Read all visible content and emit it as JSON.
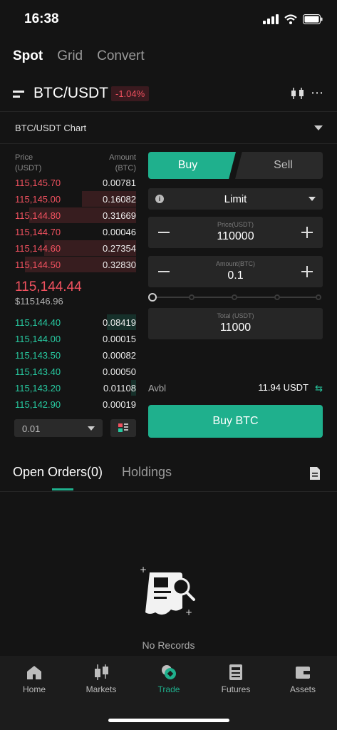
{
  "status_bar": {
    "time": "16:38"
  },
  "top_tabs": [
    "Spot",
    "Grid",
    "Convert"
  ],
  "pair": {
    "name": "BTC/USDT",
    "change": "-1.04%"
  },
  "chart": {
    "label": "BTC/USDT Chart"
  },
  "order_book": {
    "price_header": "Price",
    "price_unit": "(USDT)",
    "amount_header": "Amount",
    "amount_unit": "(BTC)",
    "asks": [
      {
        "price": "115,145.70",
        "amount": "0.00781",
        "depth": 0.0
      },
      {
        "price": "115,145.00",
        "amount": "0.16082",
        "depth": 0.45
      },
      {
        "price": "115,144.80",
        "amount": "0.31669",
        "depth": 0.88
      },
      {
        "price": "115,144.70",
        "amount": "0.00046",
        "depth": 0.0
      },
      {
        "price": "115,144.60",
        "amount": "0.27354",
        "depth": 0.76
      },
      {
        "price": "115,144.50",
        "amount": "0.32830",
        "depth": 0.92
      }
    ],
    "last_price": "115,144.44",
    "last_price_usd": "$115146.96",
    "bids": [
      {
        "price": "115,144.40",
        "amount": "0.08419",
        "depth": 0.24
      },
      {
        "price": "115,144.00",
        "amount": "0.00015",
        "depth": 0.0
      },
      {
        "price": "115,143.50",
        "amount": "0.00082",
        "depth": 0.0
      },
      {
        "price": "115,143.40",
        "amount": "0.00050",
        "depth": 0.0
      },
      {
        "price": "115,143.20",
        "amount": "0.01108",
        "depth": 0.04
      },
      {
        "price": "115,142.90",
        "amount": "0.00019",
        "depth": 0.0
      }
    ],
    "precision": "0.01"
  },
  "trade": {
    "buy_tab": "Buy",
    "sell_tab": "Sell",
    "order_type": "Limit",
    "price_label": "Price(USDT)",
    "price_value": "110000",
    "amount_label": "Amount(BTC)",
    "amount_value": "0.1",
    "total_label": "Total (USDT)",
    "total_value": "11000",
    "avbl_label": "Avbl",
    "avbl_value": "11.94 USDT",
    "buy_button": "Buy BTC",
    "slider_level": 0
  },
  "orders": {
    "open_orders_tab": "Open Orders(0)",
    "holdings_tab": "Holdings",
    "empty_text": "No Records"
  },
  "bottom_nav": [
    {
      "label": "Home",
      "icon": "home-icon"
    },
    {
      "label": "Markets",
      "icon": "candlestick-icon"
    },
    {
      "label": "Trade",
      "icon": "trade-icon"
    },
    {
      "label": "Futures",
      "icon": "futures-icon"
    },
    {
      "label": "Assets",
      "icon": "wallet-icon"
    }
  ],
  "colors": {
    "accent": "#1fb08d",
    "sell": "#f0515f",
    "buy": "#27c9a0"
  }
}
